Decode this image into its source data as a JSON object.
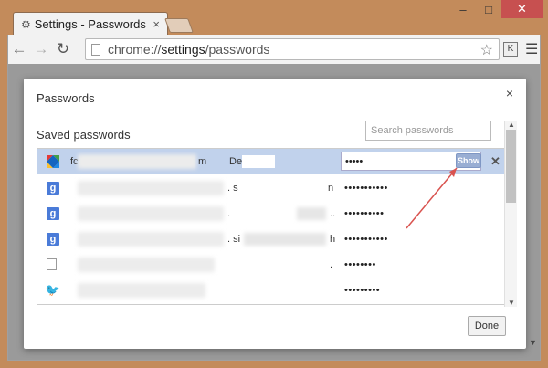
{
  "window": {
    "tab_title": "Settings - Passwords",
    "tab_close": "×",
    "minimize": "–",
    "maximize": "□",
    "close": "✕"
  },
  "toolbar": {
    "url_prefix": "chrome://",
    "url_host": "settings",
    "url_path": "/passwords",
    "extension_label": "K"
  },
  "dialog": {
    "title": "Passwords",
    "section_title": "Saved passwords",
    "search_placeholder": "Search passwords",
    "done_label": "Done",
    "close_glyph": "×"
  },
  "rows": [
    {
      "icon": "kite-icon",
      "site_start": "fc",
      "site_end": "m",
      "user": "De",
      "password": "•••••",
      "selected": true,
      "show_label": "Show",
      "delete": "✕"
    },
    {
      "icon": "google-icon",
      "frag1": ". s",
      "frag2": "n",
      "password": "•••••••••••"
    },
    {
      "icon": "google-icon",
      "frag1": ".",
      "frag2": "..",
      "password": "••••••••••"
    },
    {
      "icon": "google-icon",
      "frag1": ". si",
      "frag2": "h",
      "password": "•••••••••••"
    },
    {
      "icon": "document-icon",
      "frag1": "",
      "frag2": ".",
      "password": "••••••••"
    },
    {
      "icon": "twitter-icon",
      "frag1": "",
      "frag2": "",
      "password": "•••••••••"
    }
  ],
  "colors": {
    "selected_row": "#c1d2ec",
    "show_button": "#99aed3",
    "annotation_arrow": "#d9534f",
    "frame": "#c38b5b"
  }
}
